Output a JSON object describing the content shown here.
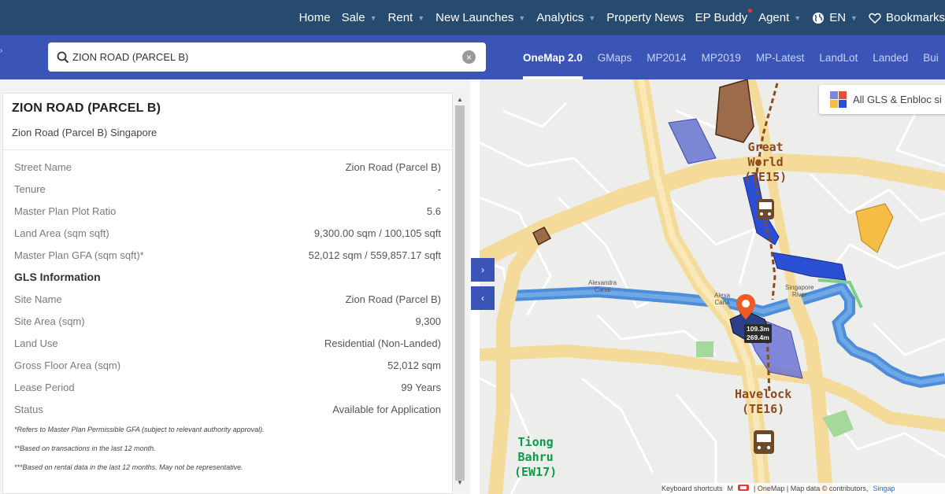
{
  "topnav": {
    "items": [
      {
        "label": "Home",
        "caret": false
      },
      {
        "label": "Sale",
        "caret": true
      },
      {
        "label": "Rent",
        "caret": true
      },
      {
        "label": "New Launches",
        "caret": true
      },
      {
        "label": "Analytics",
        "caret": true
      },
      {
        "label": "Property News",
        "caret": false
      },
      {
        "label": "EP Buddy",
        "caret": false
      },
      {
        "label": "Agent",
        "caret": true
      },
      {
        "label": "EN",
        "caret": true
      },
      {
        "label": "Bookmarks",
        "caret": false
      }
    ]
  },
  "search": {
    "value": "ZION ROAD (PARCEL B)",
    "placeholder": ""
  },
  "maptabs": [
    "OneMap 2.0",
    "GMaps",
    "MP2014",
    "MP2019",
    "MP-Latest",
    "LandLot",
    "Landed",
    "Bui"
  ],
  "active_tab": "OneMap 2.0",
  "panel": {
    "title": "ZION ROAD (PARCEL B)",
    "subtitle": "Zion Road (Parcel B) Singapore",
    "details": [
      {
        "k": "Street Name",
        "v": "Zion Road (Parcel B)"
      },
      {
        "k": "Tenure",
        "v": "-"
      },
      {
        "k": "Master Plan Plot Ratio",
        "v": "5.6"
      },
      {
        "k": "Land Area (sqm sqft)",
        "v": "9,300.00 sqm / 100,105 sqft"
      },
      {
        "k": "Master Plan GFA (sqm sqft)*",
        "v": "52,012 sqm / 559,857.17 sqft"
      }
    ],
    "gls_title": "GLS Information",
    "gls": [
      {
        "k": "Site Name",
        "v": "Zion Road (Parcel B)"
      },
      {
        "k": "Site Area (sqm)",
        "v": "9,300"
      },
      {
        "k": "Land Use",
        "v": "Residential (Non-Landed)"
      },
      {
        "k": "Gross Floor Area (sqm)",
        "v": "52,012 sqm"
      },
      {
        "k": "Lease Period",
        "v": "99 Years"
      },
      {
        "k": "Status",
        "v": "Available for Application"
      }
    ],
    "notes": [
      "*Refers to Master Plan Permissible GFA (subject to relevant authority approval).",
      "**Based on transactions in the last 12 month.",
      "***Based on rental data in the last 12 months. May not be representative."
    ]
  },
  "map": {
    "legend_label": "All GLS & Enbloc si",
    "stations": [
      {
        "name": "Great\nWorld\n(TE15)"
      },
      {
        "name": "Havelock\n(TE16)"
      },
      {
        "name": "Tiong\nBahru\n(EW17)"
      }
    ],
    "canal_labels": [
      "Alexandra\nCanal",
      "Alexa\nCana",
      "Singapore\nRiver"
    ],
    "measure": {
      "line1": "109.3m",
      "line2": "269.4m"
    },
    "attribution": {
      "shortcuts": "Keyboard shortcuts",
      "m": "M",
      "onemap": "| OneMap | Map data © contributors,",
      "link": "Singap"
    },
    "toggle_right": "›",
    "toggle_left": "‹"
  },
  "colors": {
    "nav_bg": "#264b6e",
    "search_bar_bg": "#3b55b6",
    "gls_blue": "#2b4fd4",
    "station_brown": "#8b4a1d",
    "station_green": "#0b9b4b",
    "pin_orange": "#f05a24"
  }
}
